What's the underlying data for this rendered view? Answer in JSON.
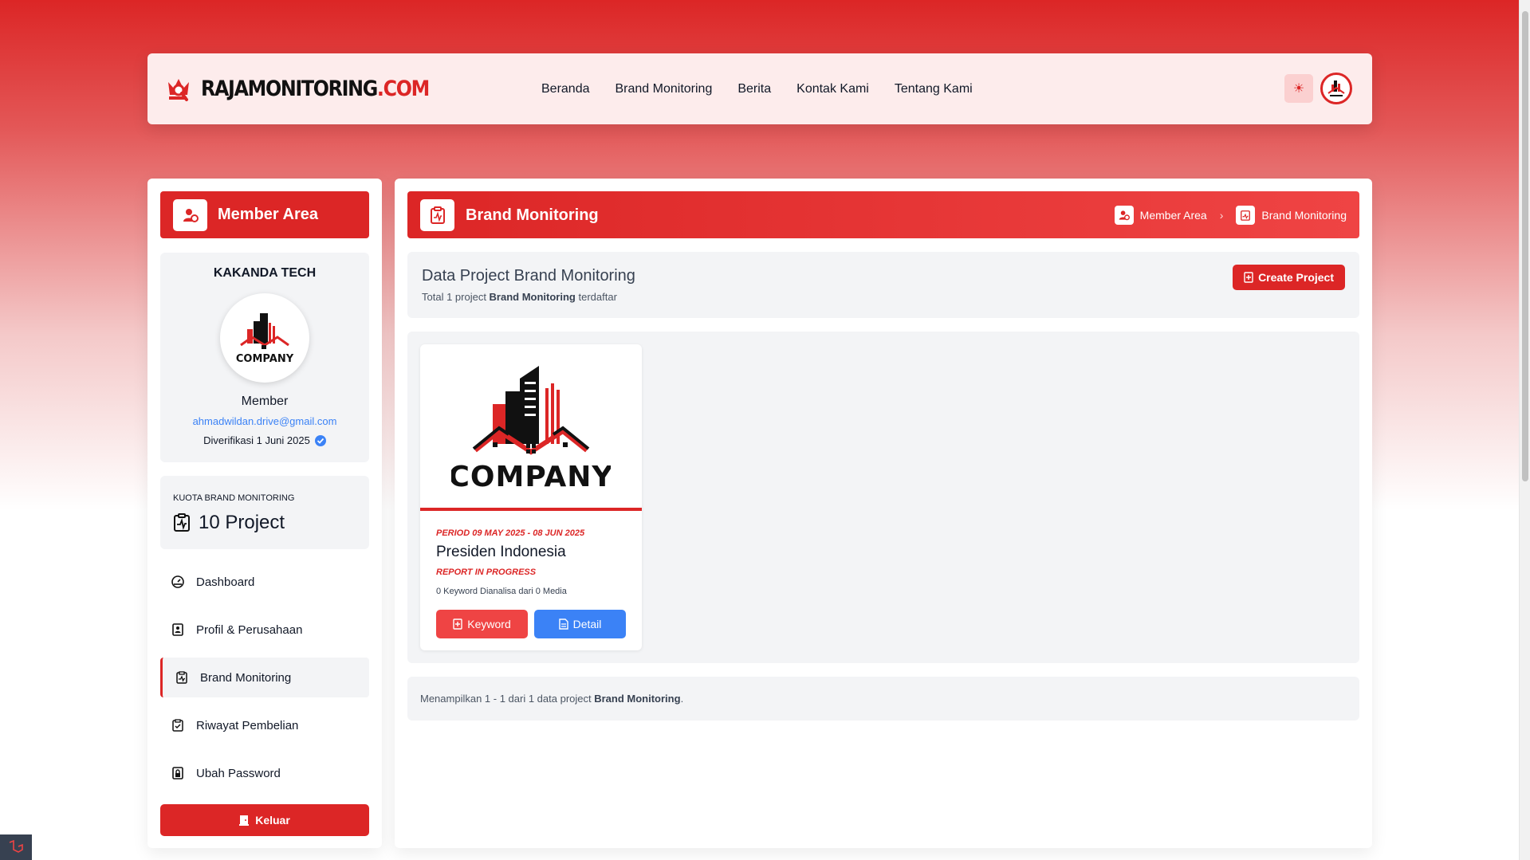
{
  "brand": {
    "name_part1": "RAJAMONITORING",
    "name_part2": ".COM"
  },
  "nav": {
    "items": [
      {
        "label": "Beranda"
      },
      {
        "label": "Brand Monitoring"
      },
      {
        "label": "Berita"
      },
      {
        "label": "Kontak Kami"
      },
      {
        "label": "Tentang Kami"
      }
    ],
    "theme_icon": "☀"
  },
  "sidebar": {
    "header_title": "Member Area",
    "profile": {
      "company_name": "KAKANDA TECH",
      "logo_text": "COMPANY",
      "role": "Member",
      "email": "ahmadwildan.drive@gmail.com",
      "verified_text": "Diverifikasi 1 Juni 2025"
    },
    "quota": {
      "label": "KUOTA BRAND MONITORING",
      "value": "10 Project"
    },
    "menu": [
      {
        "label": "Dashboard",
        "icon": "dashboard-icon"
      },
      {
        "label": "Profil & Perusahaan",
        "icon": "profile-icon"
      },
      {
        "label": "Brand Monitoring",
        "icon": "monitoring-icon",
        "active": true
      },
      {
        "label": "Riwayat Pembelian",
        "icon": "history-icon"
      },
      {
        "label": "Ubah Password",
        "icon": "lock-icon"
      }
    ],
    "logout_label": "Keluar"
  },
  "main": {
    "header_title": "Brand Monitoring",
    "breadcrumb": [
      {
        "label": "Member Area"
      },
      {
        "label": "Brand Monitoring"
      }
    ],
    "info": {
      "title": "Data Project Brand Monitoring",
      "subtitle_prefix": "Total 1 project ",
      "subtitle_bold": "Brand Monitoring",
      "subtitle_suffix": " terdaftar"
    },
    "create_label": "Create Project",
    "projects": [
      {
        "logo_text": "COMPANY",
        "period": "PERIOD 09 MAY 2025 - 08 JUN 2025",
        "title": "Presiden Indonesia",
        "status": "REPORT IN PROGRESS",
        "stat": "0 Keyword Dianalisa dari 0 Media",
        "keyword_label": "Keyword",
        "detail_label": "Detail"
      }
    ],
    "footer": {
      "prefix": "Menampilkan 1 - 1 dari 1 data project ",
      "bold": "Brand Monitoring",
      "suffix": "."
    }
  },
  "colors": {
    "primary": "#dc2626",
    "accent_blue": "#3b82f6",
    "panel": "#f3f4f6"
  }
}
